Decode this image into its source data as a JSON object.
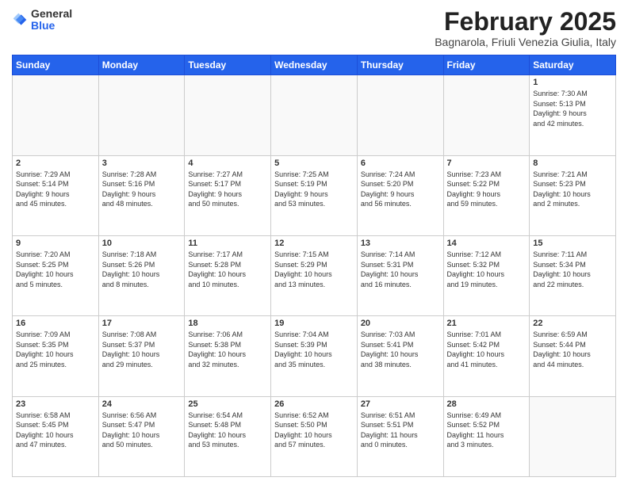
{
  "header": {
    "logo_line1": "General",
    "logo_line2": "Blue",
    "month_title": "February 2025",
    "location": "Bagnarola, Friuli Venezia Giulia, Italy"
  },
  "weekdays": [
    "Sunday",
    "Monday",
    "Tuesday",
    "Wednesday",
    "Thursday",
    "Friday",
    "Saturday"
  ],
  "weeks": [
    [
      {
        "day": "",
        "info": ""
      },
      {
        "day": "",
        "info": ""
      },
      {
        "day": "",
        "info": ""
      },
      {
        "day": "",
        "info": ""
      },
      {
        "day": "",
        "info": ""
      },
      {
        "day": "",
        "info": ""
      },
      {
        "day": "1",
        "info": "Sunrise: 7:30 AM\nSunset: 5:13 PM\nDaylight: 9 hours\nand 42 minutes."
      }
    ],
    [
      {
        "day": "2",
        "info": "Sunrise: 7:29 AM\nSunset: 5:14 PM\nDaylight: 9 hours\nand 45 minutes."
      },
      {
        "day": "3",
        "info": "Sunrise: 7:28 AM\nSunset: 5:16 PM\nDaylight: 9 hours\nand 48 minutes."
      },
      {
        "day": "4",
        "info": "Sunrise: 7:27 AM\nSunset: 5:17 PM\nDaylight: 9 hours\nand 50 minutes."
      },
      {
        "day": "5",
        "info": "Sunrise: 7:25 AM\nSunset: 5:19 PM\nDaylight: 9 hours\nand 53 minutes."
      },
      {
        "day": "6",
        "info": "Sunrise: 7:24 AM\nSunset: 5:20 PM\nDaylight: 9 hours\nand 56 minutes."
      },
      {
        "day": "7",
        "info": "Sunrise: 7:23 AM\nSunset: 5:22 PM\nDaylight: 9 hours\nand 59 minutes."
      },
      {
        "day": "8",
        "info": "Sunrise: 7:21 AM\nSunset: 5:23 PM\nDaylight: 10 hours\nand 2 minutes."
      }
    ],
    [
      {
        "day": "9",
        "info": "Sunrise: 7:20 AM\nSunset: 5:25 PM\nDaylight: 10 hours\nand 5 minutes."
      },
      {
        "day": "10",
        "info": "Sunrise: 7:18 AM\nSunset: 5:26 PM\nDaylight: 10 hours\nand 8 minutes."
      },
      {
        "day": "11",
        "info": "Sunrise: 7:17 AM\nSunset: 5:28 PM\nDaylight: 10 hours\nand 10 minutes."
      },
      {
        "day": "12",
        "info": "Sunrise: 7:15 AM\nSunset: 5:29 PM\nDaylight: 10 hours\nand 13 minutes."
      },
      {
        "day": "13",
        "info": "Sunrise: 7:14 AM\nSunset: 5:31 PM\nDaylight: 10 hours\nand 16 minutes."
      },
      {
        "day": "14",
        "info": "Sunrise: 7:12 AM\nSunset: 5:32 PM\nDaylight: 10 hours\nand 19 minutes."
      },
      {
        "day": "15",
        "info": "Sunrise: 7:11 AM\nSunset: 5:34 PM\nDaylight: 10 hours\nand 22 minutes."
      }
    ],
    [
      {
        "day": "16",
        "info": "Sunrise: 7:09 AM\nSunset: 5:35 PM\nDaylight: 10 hours\nand 25 minutes."
      },
      {
        "day": "17",
        "info": "Sunrise: 7:08 AM\nSunset: 5:37 PM\nDaylight: 10 hours\nand 29 minutes."
      },
      {
        "day": "18",
        "info": "Sunrise: 7:06 AM\nSunset: 5:38 PM\nDaylight: 10 hours\nand 32 minutes."
      },
      {
        "day": "19",
        "info": "Sunrise: 7:04 AM\nSunset: 5:39 PM\nDaylight: 10 hours\nand 35 minutes."
      },
      {
        "day": "20",
        "info": "Sunrise: 7:03 AM\nSunset: 5:41 PM\nDaylight: 10 hours\nand 38 minutes."
      },
      {
        "day": "21",
        "info": "Sunrise: 7:01 AM\nSunset: 5:42 PM\nDaylight: 10 hours\nand 41 minutes."
      },
      {
        "day": "22",
        "info": "Sunrise: 6:59 AM\nSunset: 5:44 PM\nDaylight: 10 hours\nand 44 minutes."
      }
    ],
    [
      {
        "day": "23",
        "info": "Sunrise: 6:58 AM\nSunset: 5:45 PM\nDaylight: 10 hours\nand 47 minutes."
      },
      {
        "day": "24",
        "info": "Sunrise: 6:56 AM\nSunset: 5:47 PM\nDaylight: 10 hours\nand 50 minutes."
      },
      {
        "day": "25",
        "info": "Sunrise: 6:54 AM\nSunset: 5:48 PM\nDaylight: 10 hours\nand 53 minutes."
      },
      {
        "day": "26",
        "info": "Sunrise: 6:52 AM\nSunset: 5:50 PM\nDaylight: 10 hours\nand 57 minutes."
      },
      {
        "day": "27",
        "info": "Sunrise: 6:51 AM\nSunset: 5:51 PM\nDaylight: 11 hours\nand 0 minutes."
      },
      {
        "day": "28",
        "info": "Sunrise: 6:49 AM\nSunset: 5:52 PM\nDaylight: 11 hours\nand 3 minutes."
      },
      {
        "day": "",
        "info": ""
      }
    ]
  ]
}
